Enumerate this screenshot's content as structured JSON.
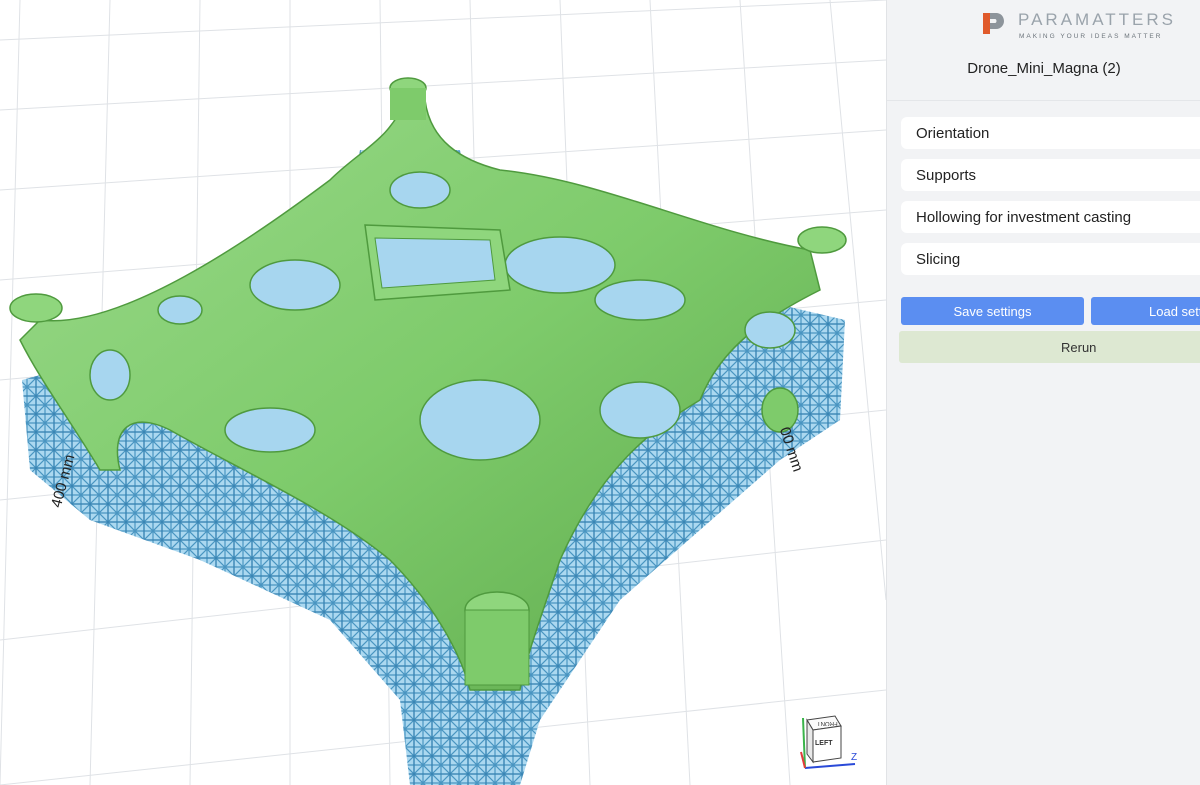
{
  "viewport": {
    "dimension_left": "400 mm",
    "dimension_right": "00 mm",
    "view_cube": {
      "face": "LEFT",
      "top_face": "FRONT",
      "axis_x": "X",
      "axis_z": "Z"
    }
  },
  "panel": {
    "logo": {
      "name": "PARAMATTERS",
      "tagline": "MAKING YOUR IDEAS MATTER"
    },
    "project_title": "Drone_Mini_Magna (2)",
    "sections": [
      {
        "label": "Orientation"
      },
      {
        "label": "Supports"
      },
      {
        "label": "Hollowing for investment casting"
      },
      {
        "label": "Slicing"
      }
    ],
    "save_label": "Save settings",
    "load_label": "Load settings",
    "rerun_label": "Rerun"
  },
  "colors": {
    "part": "#7ecb6b",
    "support": "#6cb4dc",
    "button": "#5b8ef1",
    "rerun": "#dde8d2",
    "panel": "#f2f3f5"
  }
}
